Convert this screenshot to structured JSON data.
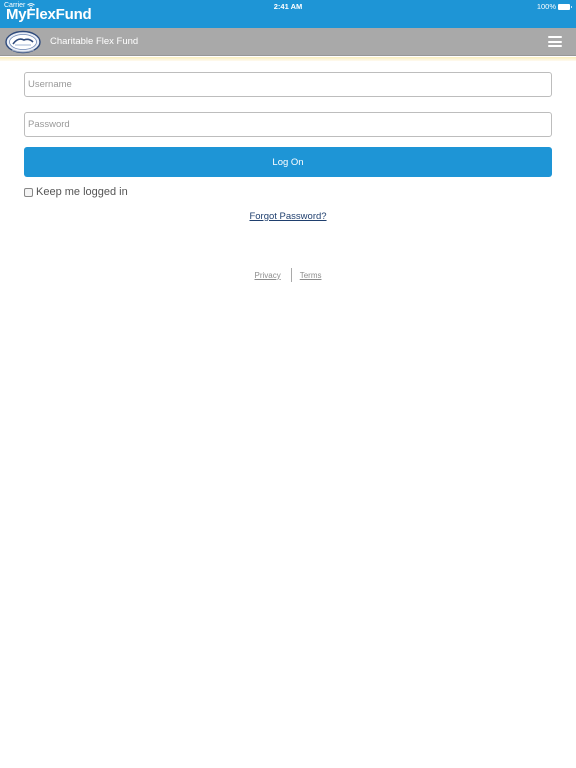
{
  "status_bar": {
    "carrier": "Carrier",
    "time": "2:41 AM",
    "battery": "100%",
    "wifi_icon": "wifi-icon",
    "battery_icon": "battery-icon"
  },
  "app": {
    "title": "MyFlexFund",
    "brand_color": "#1e95d6"
  },
  "header": {
    "org_name": "Charitable Flex Fund",
    "logo_icon": "fund-logo",
    "menu_icon": "hamburger-menu-icon",
    "header_color": "#a9a9a9"
  },
  "login_form": {
    "username_placeholder": "Username",
    "username_value": "",
    "password_placeholder": "Password",
    "password_value": "",
    "logon_label": "Log On",
    "remember_label": "Keep me logged in",
    "remember_checked": false,
    "forgot_link": "Forgot Password?"
  },
  "footer": {
    "privacy": "Privacy",
    "terms": "Terms"
  }
}
